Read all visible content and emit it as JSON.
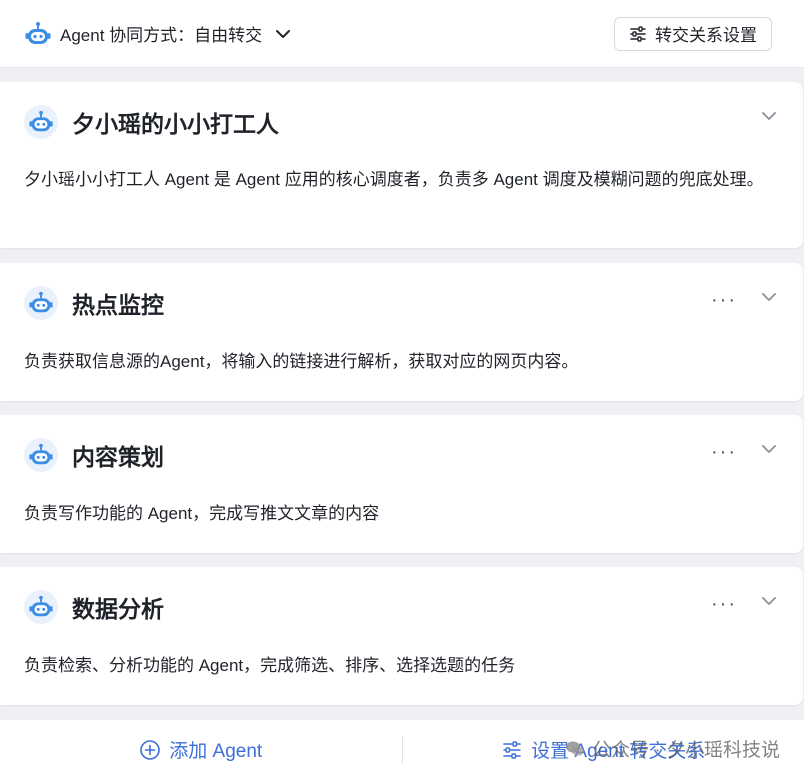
{
  "header": {
    "mode_label": "Agent 协同方式：自由转交",
    "config_button": "转交关系设置"
  },
  "agents": [
    {
      "name": "夕小瑶的小小打工人",
      "description": "夕小瑶小小打工人 Agent 是 Agent 应用的核心调度者，负责多 Agent 调度及模糊问题的兜底处理。",
      "has_more": false
    },
    {
      "name": "热点监控",
      "description": "负责获取信息源的Agent，将输入的链接进行解析，获取对应的网页内容。",
      "has_more": true
    },
    {
      "name": "内容策划",
      "description": "负责写作功能的 Agent，完成写推文文章的内容",
      "has_more": true
    },
    {
      "name": "数据分析",
      "description": "负责检索、分析功能的 Agent，完成筛选、排序、选择选题的任务",
      "has_more": true
    }
  ],
  "footer": {
    "add_agent": "添加 Agent",
    "set_relation": "设置 Agent 转交关系"
  },
  "watermark": "公众号 · 夕小瑶科技说",
  "colors": {
    "accent": "#3e6fd8",
    "robot": "#3b8ee6",
    "robot_bg": "#e9f2fc"
  }
}
